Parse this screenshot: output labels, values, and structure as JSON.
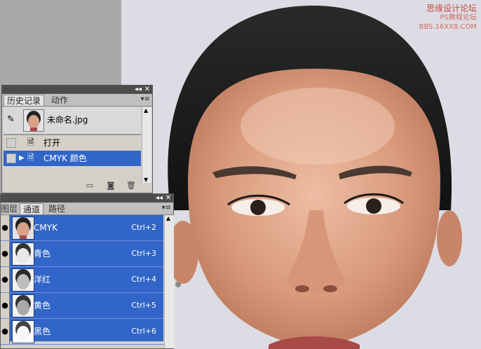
{
  "watermark": {
    "line1": "思缘设计论坛",
    "line2": "PS教程论坛",
    "line3": "BBS.16XX8.COM"
  },
  "history_panel": {
    "tabs": [
      "历史记录",
      "动作"
    ],
    "snapshot_label": "未命名.jpg",
    "states": [
      {
        "label": "打开",
        "selected": false
      },
      {
        "label": "CMYK 颜色",
        "selected": true
      }
    ],
    "footer_icons": [
      "new-document-icon",
      "snapshot-camera-icon",
      "trash-icon"
    ]
  },
  "channels_panel": {
    "tabs": [
      "图层",
      "通道",
      "路径"
    ],
    "active_tab": "通道",
    "channels": [
      {
        "name": "CMYK",
        "shortcut": "Ctrl+2"
      },
      {
        "name": "青色",
        "shortcut": "Ctrl+3"
      },
      {
        "name": "洋红",
        "shortcut": "Ctrl+4"
      },
      {
        "name": "黄色",
        "shortcut": "Ctrl+5"
      },
      {
        "name": "黑色",
        "shortcut": "Ctrl+6"
      }
    ]
  },
  "colors": {
    "selection_blue": "#3165c8",
    "panel_gray": "#d4d0c8",
    "workspace_gray": "#a9a9a9"
  }
}
